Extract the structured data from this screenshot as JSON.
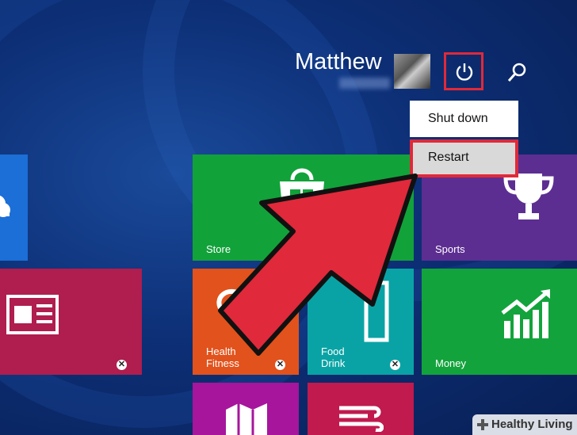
{
  "user": {
    "name": "Matthew"
  },
  "power_menu": {
    "shutdown_label": "Shut down",
    "restart_label": "Restart"
  },
  "tiles": {
    "store": {
      "label": "Store",
      "color": "#12a23a"
    },
    "sports": {
      "label": "Sports",
      "color": "#5c2e91"
    },
    "health": {
      "label": "Health &\nFitness",
      "line1": "Health",
      "line2": "Fitness",
      "color": "#e2521c"
    },
    "food": {
      "line1": "Food",
      "line2": "Drink",
      "color": "#0aa3a5"
    },
    "money": {
      "label": "Money",
      "color": "#13a33c"
    },
    "news": {
      "color": "#b01d4f"
    },
    "skydrive": {
      "color": "#1b6fd6"
    },
    "maps": {
      "color": "#a6159c"
    },
    "travel": {
      "color": "#c01a4f"
    }
  },
  "icons": [
    "power-icon",
    "search-icon",
    "store-bag-icon",
    "trophy-icon",
    "heart-pulse-icon",
    "chart-up-icon",
    "news-icon",
    "cloud-icon",
    "map-icon",
    "weather-icon"
  ],
  "colors": {
    "highlight": "#e0293a",
    "arrow": "#e0293a"
  },
  "watermark": {
    "text": "Healthy Living"
  }
}
